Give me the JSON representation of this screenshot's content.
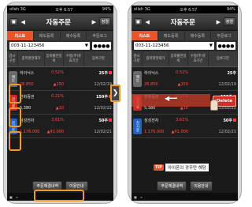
{
  "status": {
    "carrier": "olleh",
    "network": "3G",
    "time": "오후 6:57",
    "battery": "94%"
  },
  "titlebar": {
    "title": "자동주문",
    "left_btn": "■",
    "right_btn": "정렬"
  },
  "tabs": [
    "리스트",
    "매도등록",
    "매수등록",
    "주문로그"
  ],
  "account": {
    "number": "003-11-123456",
    "password": "●●●●"
  },
  "table_header": [
    "감시구분",
    "종목명현재가",
    "등락률전일비",
    "수량(주)유효기간",
    "등록구분"
  ],
  "rows": [
    {
      "kind": "매도",
      "kind_class": "mod",
      "name": "하이닉스",
      "change": "0.52%",
      "pct": "",
      "qty": "25주",
      "price": "28,850",
      "price_class": "red",
      "diff": "▲150",
      "date": "12/02/19"
    },
    {
      "kind": "감시중",
      "kind_class": "buy",
      "name": "한화증권",
      "change": "0.21%",
      "pct": "",
      "qty": "150주",
      "price": "5,380",
      "price_class": "",
      "diff": "▲10",
      "date": "12/02/22"
    },
    {
      "kind": "감시중",
      "kind_class": "sell",
      "name": "삼성전자",
      "change": "3.61%",
      "pct": "",
      "qty": "50주",
      "price": "1,176,000",
      "price_class": "red",
      "diff": "▲41,000",
      "date": "12/02/21"
    }
  ],
  "footer": {
    "btn_log": "주문체결내역",
    "btn_help": "이용안내"
  },
  "right": {
    "delete_label": "Delete",
    "tip_badge": "TIP",
    "tip_text": "아이폰의 경우만 해당"
  }
}
